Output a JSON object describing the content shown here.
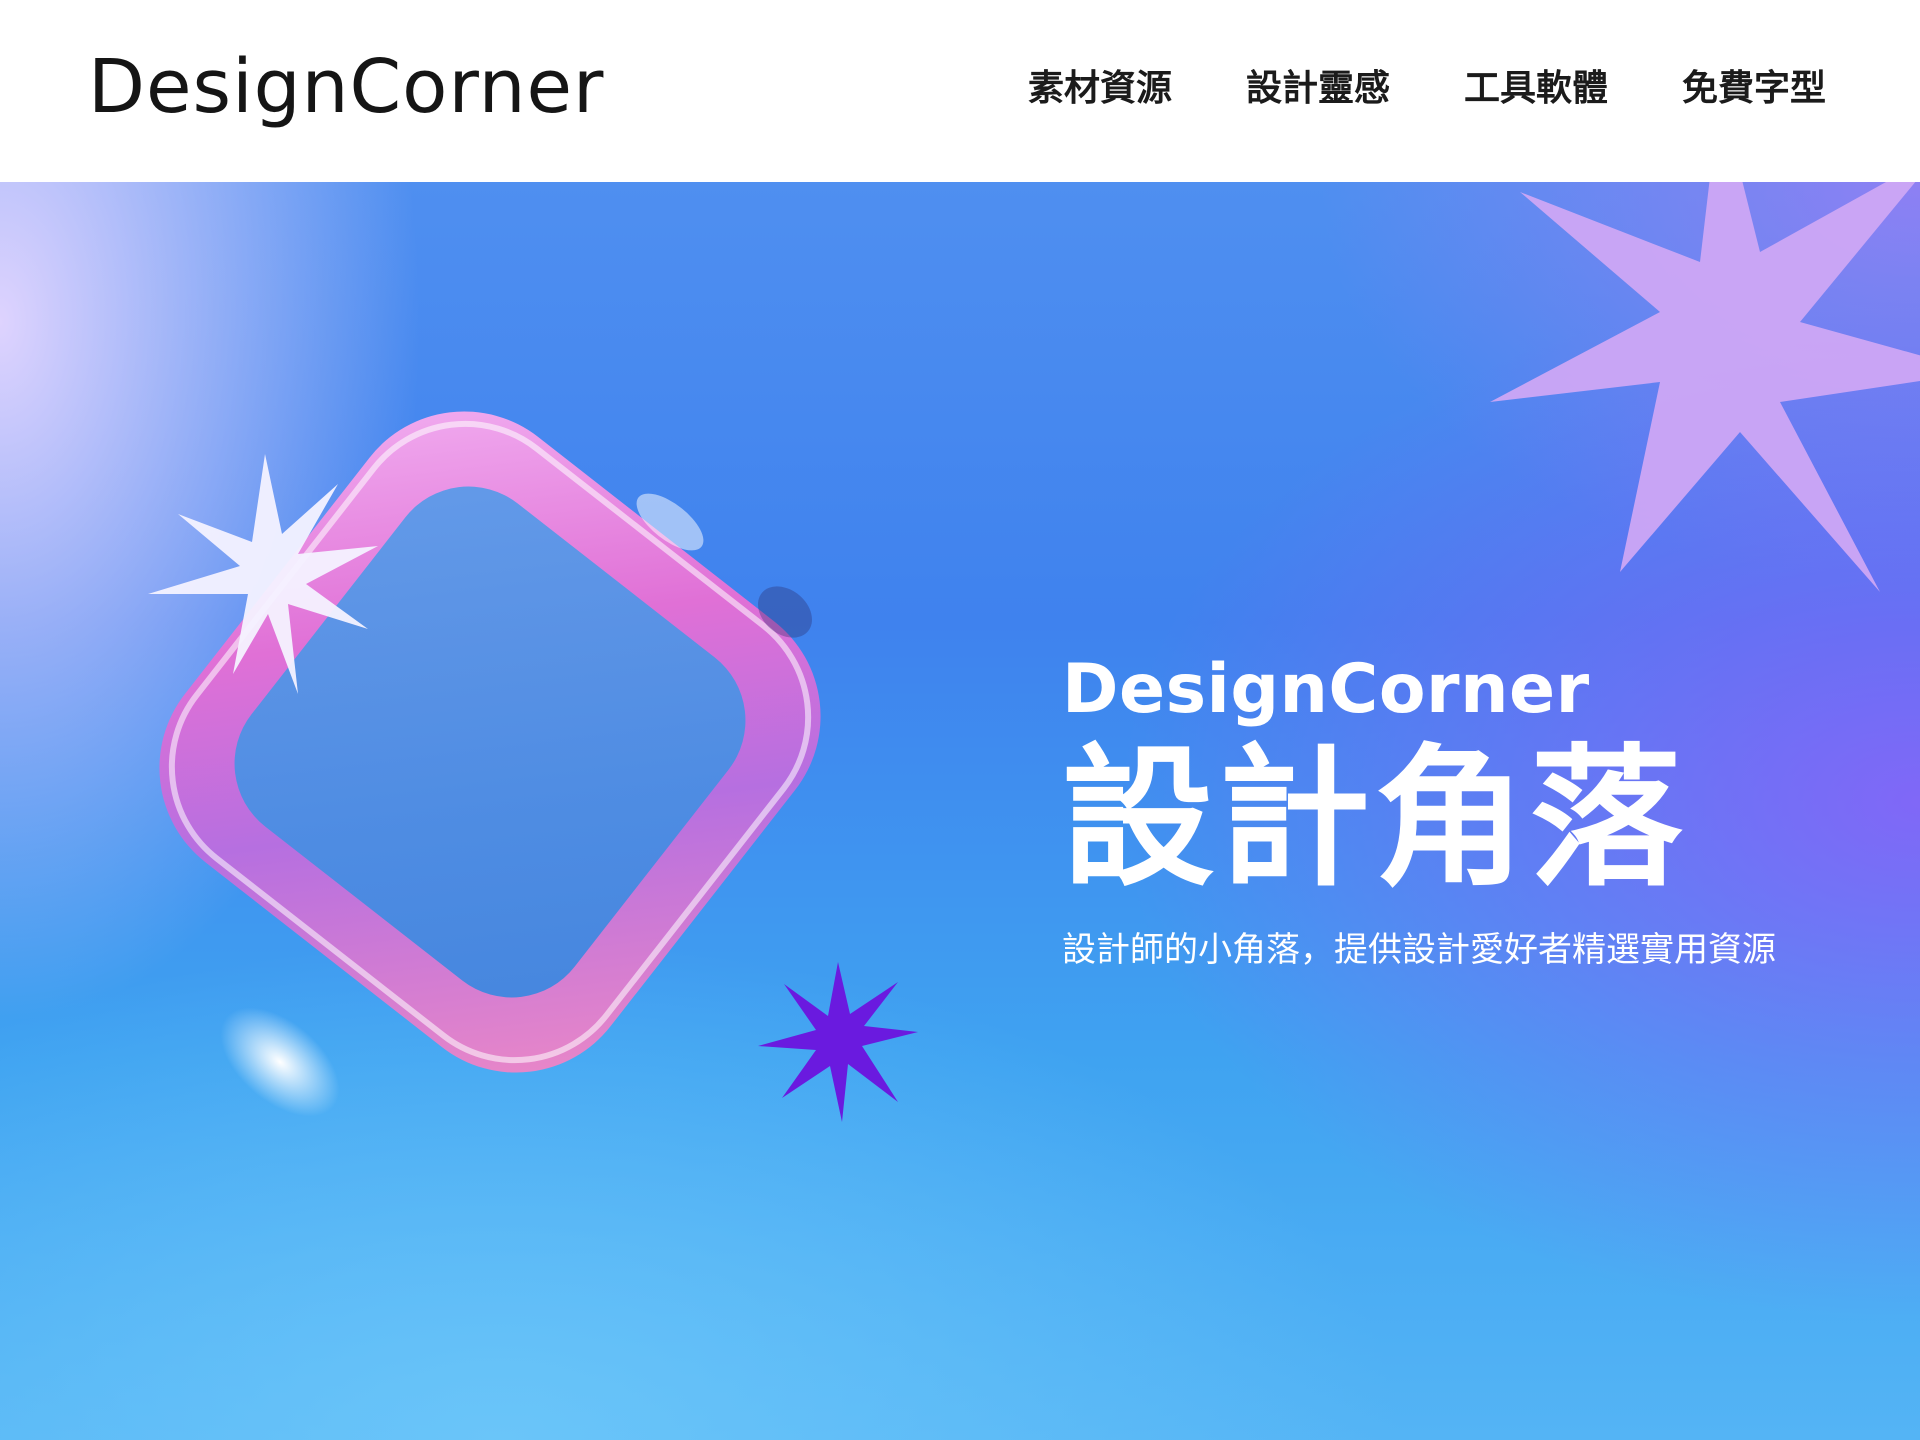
{
  "header": {
    "logo": "DesignCorner",
    "nav": [
      {
        "label": "素材資源"
      },
      {
        "label": "設計靈感"
      },
      {
        "label": "工具軟體"
      },
      {
        "label": "免費字型"
      }
    ]
  },
  "hero": {
    "brand": "DesignCorner",
    "title": "設計角落",
    "subtitle": "設計師的小角落，提供設計愛好者精選實用資源"
  },
  "colors": {
    "header_bg": "#ffffff",
    "text_dark": "#151515",
    "hero_blue": "#3f82ee",
    "hero_purple": "#9a5cf5",
    "star_white": "#f4f2ff",
    "star_violet": "#6a1adf",
    "star_lilac": "#cda6f4"
  },
  "icons": {
    "cube": "glass-cube-icon",
    "white_star": "sparkle-star-icon",
    "violet_star": "spiky-star-icon",
    "lilac_star": "large-starburst-icon"
  }
}
